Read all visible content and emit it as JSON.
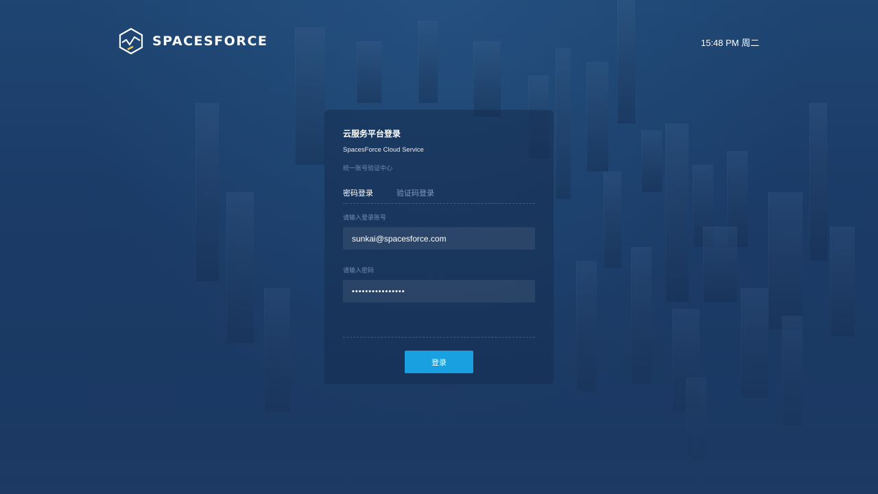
{
  "header": {
    "brand": "SPACESFORCE",
    "clock": "15:48 PM 周二"
  },
  "login": {
    "title": "云服务平台登录",
    "subtitle": "SpacesForce Cloud Service",
    "hint": "统一账号验证中心",
    "tabs": [
      {
        "label": "密码登录",
        "active": true
      },
      {
        "label": "验证码登录",
        "active": false
      }
    ],
    "account_label": "请输入登录账号",
    "account_value": "sunkai@spacesforce.com",
    "password_label": "请输入密码",
    "password_value": "••••••••••••••••",
    "submit_label": "登录"
  },
  "colors": {
    "background": "#1b3a64",
    "accent": "#18a0e0",
    "logo_accent": "#f2c94c"
  }
}
